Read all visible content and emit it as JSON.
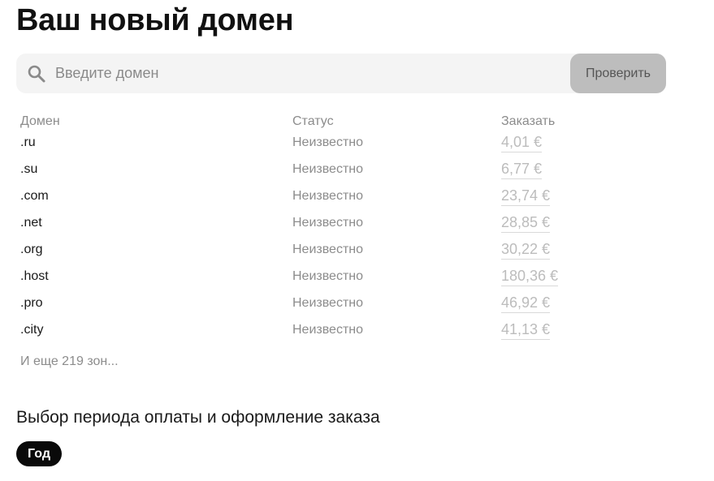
{
  "page": {
    "title": "Ваш новый домен"
  },
  "search": {
    "placeholder": "Введите домен",
    "value": "",
    "button_label": "Проверить",
    "icon": "search-icon"
  },
  "table": {
    "columns": {
      "domain": "Домен",
      "status": "Статус",
      "order": "Заказать"
    },
    "rows": [
      {
        "domain": ".ru",
        "status": "Неизвестно",
        "price": "4,01 €"
      },
      {
        "domain": ".su",
        "status": "Неизвестно",
        "price": "6,77 €"
      },
      {
        "domain": ".com",
        "status": "Неизвестно",
        "price": "23,74 €"
      },
      {
        "domain": ".net",
        "status": "Неизвестно",
        "price": "28,85 €"
      },
      {
        "domain": ".org",
        "status": "Неизвестно",
        "price": "30,22 €"
      },
      {
        "domain": ".host",
        "status": "Неизвестно",
        "price": "180,36 €"
      },
      {
        "domain": ".pro",
        "status": "Неизвестно",
        "price": "46,92 €"
      },
      {
        "domain": ".city",
        "status": "Неизвестно",
        "price": "41,13 €"
      }
    ],
    "more_zones": "И еще 219 зон..."
  },
  "payment": {
    "section_title": "Выбор периода оплаты и оформление заказа",
    "period_selected": "Год"
  },
  "colors": {
    "title": "#111111",
    "search_bg": "#f4f4f4",
    "button_bg": "#bdbdbd",
    "muted_text": "#8c8c8c",
    "price_text": "#bcbcbc",
    "pill_bg": "#0a0a0a"
  }
}
